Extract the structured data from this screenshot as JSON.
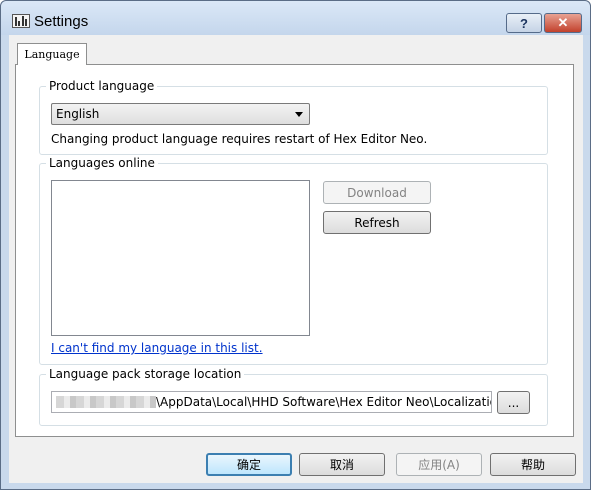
{
  "window": {
    "title": "Settings"
  },
  "caption": {
    "help_label": "?",
    "close_label": "✕"
  },
  "tabs": [
    {
      "label": "Language"
    }
  ],
  "product_language": {
    "legend": "Product language",
    "selected": "English",
    "hint": "Changing product language requires restart of Hex Editor Neo."
  },
  "languages_online": {
    "legend": "Languages online",
    "download_label": "Download",
    "refresh_label": "Refresh",
    "link_text": "I can't find my language in this list."
  },
  "storage": {
    "legend": "Language pack storage location",
    "path": "\\AppData\\Local\\HHD Software\\Hex Editor Neo\\Localization\\",
    "browse_label": "..."
  },
  "buttons": {
    "ok": "确定",
    "cancel": "取消",
    "apply": "应用(A)",
    "help": "帮助"
  },
  "icons": {
    "app": "settings-app-icon",
    "dropdown": "chevron-down-icon"
  },
  "colors": {
    "title_bg": "#c4d6ec",
    "close_bg": "#c2412c",
    "link": "#0033cc",
    "default_border": "#3c7fb1"
  }
}
